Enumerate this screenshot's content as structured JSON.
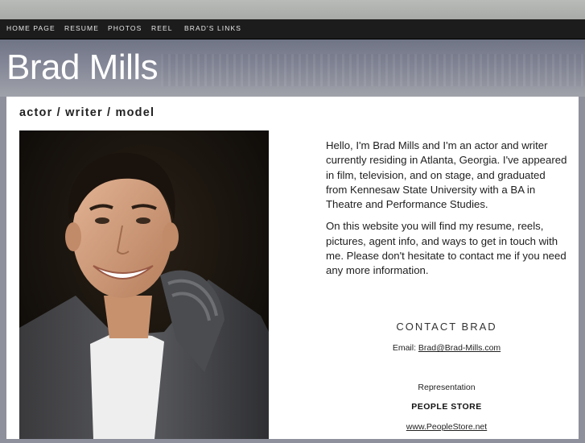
{
  "nav": {
    "items": [
      {
        "label": "HOME PAGE"
      },
      {
        "label": "RESUME"
      },
      {
        "label": "PHOTOS"
      },
      {
        "label": "REEL"
      },
      {
        "label": "BRAD'S LINKS"
      }
    ]
  },
  "header": {
    "title": "Brad Mills"
  },
  "main": {
    "tagline": "actor / writer / model",
    "intro": [
      "Hello, I'm Brad Mills and I'm an actor and writer currently residing in Atlanta, Georgia. I've appeared in film, television, and on stage, and graduated from Kennesaw State University with a BA in Theatre and Performance Studies.",
      "On this website you will find my resume, reels, pictures, agent info, and ways to get in touch with me. Please don't hesitate to contact me if you need any more information."
    ],
    "contact": {
      "heading": "CONTACT BRAD",
      "email_label": "Email:",
      "email": "Brad@Brad-Mills.com",
      "representation_label": "Representation",
      "agency": "PEOPLE STORE",
      "agency_url": "www.PeopleStore.net"
    }
  },
  "colors": {
    "nav_bg": "#1c1c1c",
    "header_bg": "#848797",
    "panel_bg": "#ffffff",
    "text": "#1e1e1e"
  }
}
